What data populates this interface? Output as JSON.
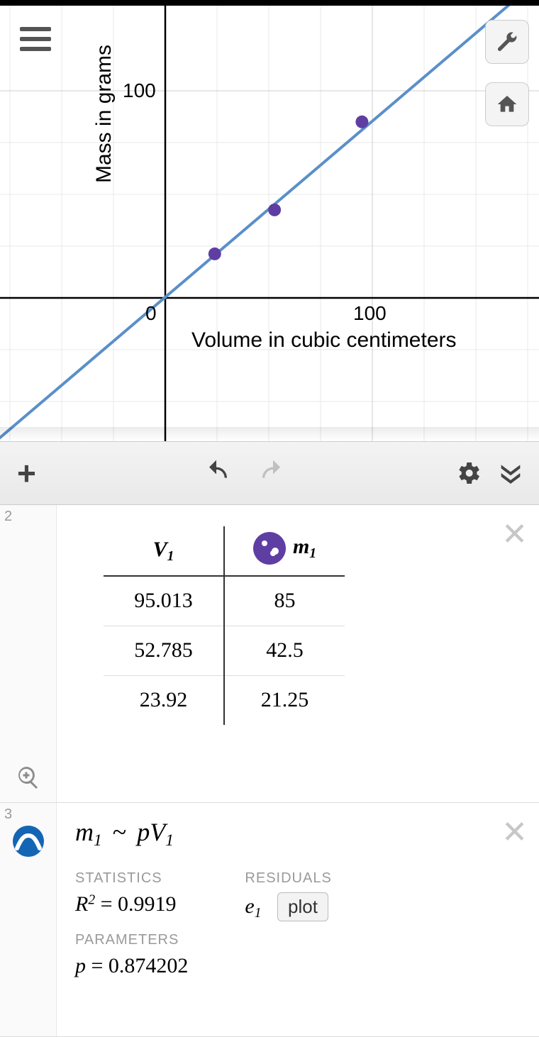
{
  "chart_data": {
    "type": "scatter",
    "title": "",
    "xlabel": "Volume in cubic centimeters",
    "ylabel": "Mass in grams",
    "xlim": [
      -80,
      180
    ],
    "ylim": [
      -70,
      140
    ],
    "x_ticks": [
      {
        "v": 0,
        "label": "0"
      },
      {
        "v": 100,
        "label": "100"
      }
    ],
    "y_ticks": [
      {
        "v": 100,
        "label": "100"
      }
    ],
    "series": [
      {
        "name": "points",
        "type": "scatter",
        "x": [
          95.013,
          52.785,
          23.92
        ],
        "y": [
          85,
          42.5,
          21.25
        ],
        "color": "#5f3ea3"
      },
      {
        "name": "fit",
        "type": "line",
        "slope": 0.874202,
        "intercept": 0,
        "color": "#5a8fc9"
      }
    ]
  },
  "graph": {
    "xlabel": "Volume in cubic centimeters",
    "ylabel": "Mass in grams",
    "origin_label": "0",
    "xtick_100": "100",
    "ytick_100": "100"
  },
  "table": {
    "index": "2",
    "col1_header_var": "V",
    "col1_header_sub": "1",
    "col2_header_var": "m",
    "col2_header_sub": "1",
    "rows": [
      {
        "v": "95.013",
        "m": "85"
      },
      {
        "v": "52.785",
        "m": "42.5"
      },
      {
        "v": "23.92",
        "m": "21.25"
      }
    ]
  },
  "regression": {
    "index": "3",
    "equation_lhs_var": "m",
    "equation_lhs_sub": "1",
    "equation_op": "~",
    "equation_rhs_a": "p",
    "equation_rhs_b": "V",
    "equation_rhs_sub": "1",
    "stats_label": "STATISTICS",
    "r2_var": "R",
    "r2_value": "0.9919",
    "residuals_label": "RESIDUALS",
    "residual_var": "e",
    "residual_sub": "1",
    "plot_button": "plot",
    "params_label": "PARAMETERS",
    "param_name": "p",
    "param_value": "0.874202"
  }
}
